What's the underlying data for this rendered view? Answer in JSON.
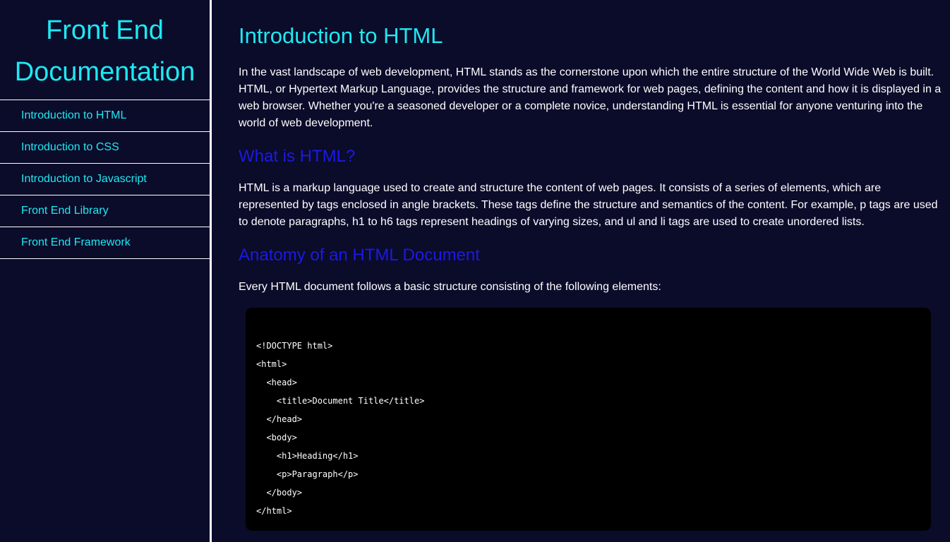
{
  "sidebar": {
    "title": "Front End Documentation",
    "items": [
      {
        "label": "Introduction to HTML"
      },
      {
        "label": "Introduction to CSS"
      },
      {
        "label": "Introduction to Javascript"
      },
      {
        "label": "Front End Library"
      },
      {
        "label": "Front End Framework"
      }
    ]
  },
  "main": {
    "title": "Introduction to HTML",
    "intro": "In the vast landscape of web development, HTML stands as the cornerstone upon which the entire structure of the World Wide Web is built. HTML, or Hypertext Markup Language, provides the structure and framework for web pages, defining the content and how it is displayed in a web browser. Whether you're a seasoned developer or a complete novice, understanding HTML is essential for anyone venturing into the world of web development.",
    "sections": [
      {
        "heading": "What is HTML?",
        "text": "HTML is a markup language used to create and structure the content of web pages. It consists of a series of elements, which are represented by tags enclosed in angle brackets. These tags define the structure and semantics of the content. For example, p tags are used to denote paragraphs, h1 to h6 tags represent headings of varying sizes, and ul and li tags are used to create unordered lists."
      },
      {
        "heading": "Anatomy of an HTML Document",
        "text": "Every HTML document follows a basic structure consisting of the following elements:"
      }
    ],
    "code_lines": [
      "<!DOCTYPE html>",
      "<html>",
      "  <head>",
      "    <title>Document Title</title>",
      "  </head>",
      "  <body>",
      "    <h1>Heading</h1>",
      "    <p>Paragraph</p>",
      "  </body>",
      "</html>"
    ]
  },
  "colors": {
    "background": "#0b0b2a",
    "accent_cyan": "#1de9f1",
    "subheading_blue": "#1a1ae6",
    "code_background": "#000000",
    "text": "#ffffff"
  }
}
